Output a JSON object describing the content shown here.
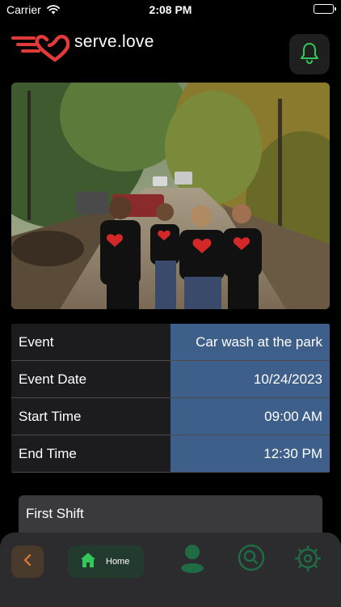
{
  "status_bar": {
    "carrier": "Carrier",
    "time": "2:08 PM"
  },
  "header": {
    "brand": "serve.love",
    "logo_icon": "heart-logo-icon",
    "notification_icon": "bell-icon"
  },
  "hero": {
    "alt": "Volunteers in matching black shirts walking down a dirt road"
  },
  "details": [
    {
      "label": "Event",
      "value": "Car wash at the park"
    },
    {
      "label": "Event Date",
      "value": "10/24/2023"
    },
    {
      "label": "Start Time",
      "value": "09:00 AM"
    },
    {
      "label": "End Time",
      "value": "12:30 PM"
    }
  ],
  "shift": {
    "title": "First Shift"
  },
  "nav": {
    "home_label": "Home",
    "icons": [
      "chevron-left-icon",
      "home-icon",
      "profile-icon",
      "search-icon",
      "settings-icon"
    ]
  },
  "colors": {
    "accent_green": "#34c759",
    "brand_red": "#e03a3a",
    "value_blue": "#3d5f8a",
    "back_orange": "#e07b39"
  }
}
